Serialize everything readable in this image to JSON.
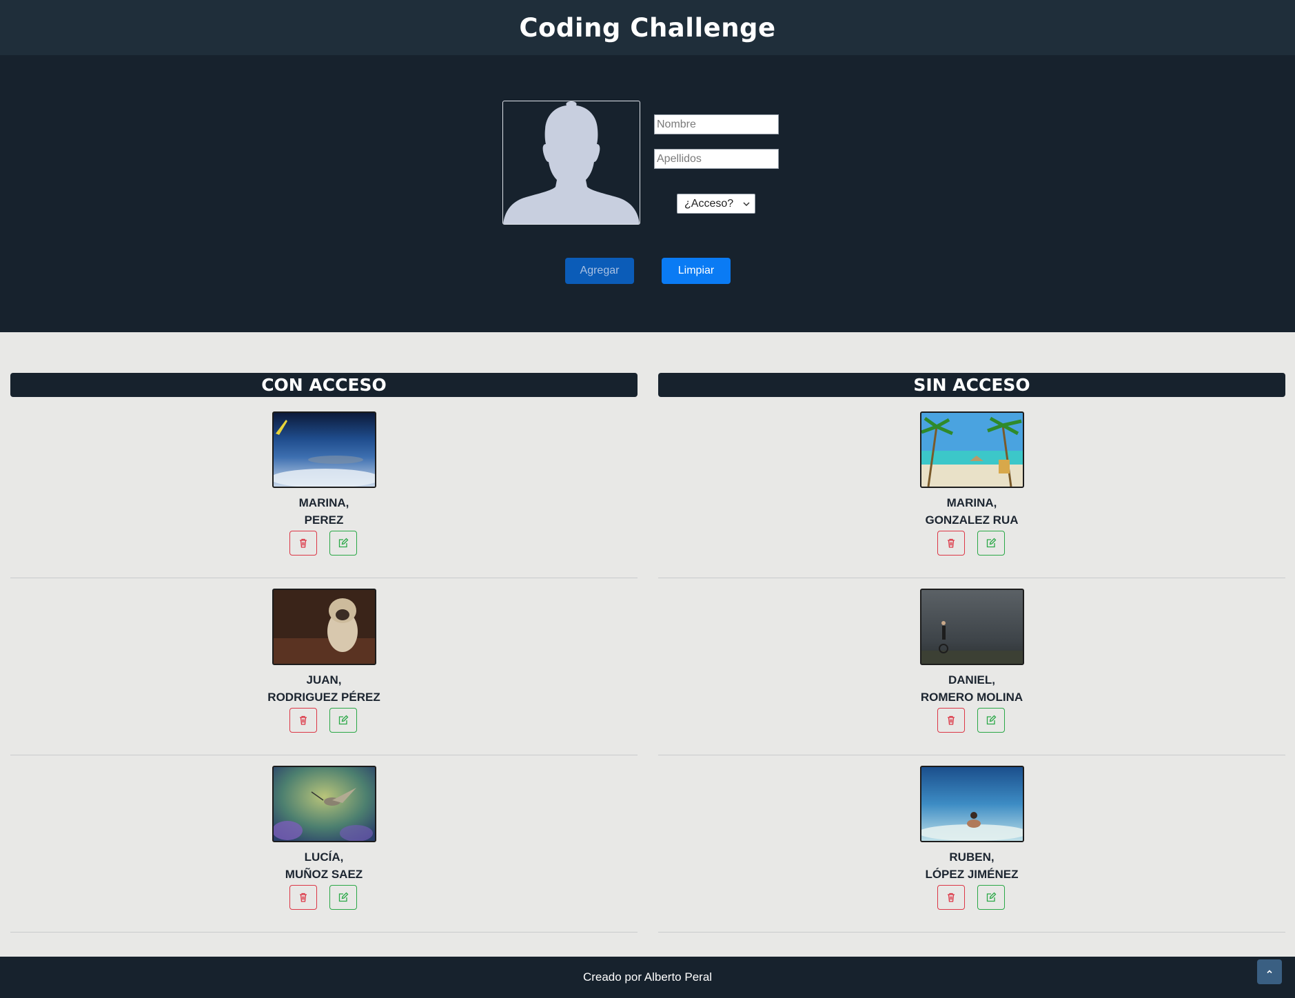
{
  "header": {
    "title": "Coding Challenge"
  },
  "form": {
    "nombre_placeholder": "Nombre",
    "apellidos_placeholder": "Apellidos",
    "acceso_select": "¿Acceso?",
    "agregar_label": "Agregar",
    "limpiar_label": "Limpiar",
    "avatar_icon": "user-silhouette-icon"
  },
  "con_acceso": {
    "title": "CON ACCESO",
    "people": [
      {
        "name": "MARINA,",
        "surname": "PEREZ",
        "photo": "earth-from-plane-photo"
      },
      {
        "name": "JUAN,",
        "surname": "RODRIGUEZ PÉREZ",
        "photo": "pug-dog-photo"
      },
      {
        "name": "LUCÍA,",
        "surname": "MUÑOZ SAEZ",
        "photo": "hummingbird-photo"
      }
    ]
  },
  "sin_acceso": {
    "title": "SIN ACCESO",
    "people": [
      {
        "name": "MARINA,",
        "surname": "GONZALEZ RUA",
        "photo": "tropical-beach-photo"
      },
      {
        "name": "DANIEL,",
        "surname": "ROMERO MOLINA",
        "photo": "unicycle-storm-photo"
      },
      {
        "name": "RUBEN,",
        "surname": "LÓPEZ JIMÉNEZ",
        "photo": "sea-swimmer-photo"
      }
    ]
  },
  "icons": {
    "delete": "trash-icon",
    "edit": "edit-icon",
    "to_top": "chevron-up-icon"
  },
  "colors": {
    "danger": "#dc3545",
    "success": "#28a745",
    "primary": "#0a7bf4",
    "dark": "#17222d"
  },
  "footer": {
    "text": "Creado por Alberto Peral"
  }
}
